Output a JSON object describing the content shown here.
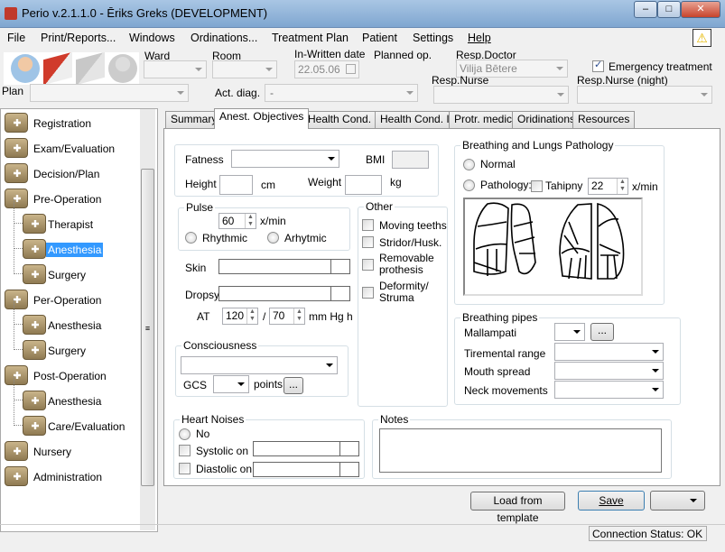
{
  "window": {
    "title": "Perio v.2.1.1.0 - Ēriks Greks (DEVELOPMENT)",
    "min": "‒",
    "max": "□",
    "close": "✕"
  },
  "menu": [
    "File",
    "Print/Reports...",
    "Windows",
    "Ordinations...",
    "Treatment Plan",
    "Patient",
    "Settings",
    "Help"
  ],
  "header": {
    "ward_label": "Ward",
    "room_label": "Room",
    "date_label": "In-Written date",
    "date_value": "22.05.06",
    "planned_label": "Planned op.",
    "doctor_label": "Resp.Doctor",
    "doctor_value": "Vilija Bētere",
    "emergency_label": "Emergency treatment",
    "emergency_checked": true,
    "plan_label": "Plan",
    "diag_label": "Act. diag.",
    "diag_value": "-",
    "nurse_label": "Resp.Nurse",
    "night_nurse_label": "Resp.Nurse (night)"
  },
  "sidebar": [
    {
      "label": "Registration",
      "level": 0
    },
    {
      "label": "Exam/Evaluation",
      "level": 0
    },
    {
      "label": "Decision/Plan",
      "level": 0
    },
    {
      "label": "Pre-Operation",
      "level": 0
    },
    {
      "label": "Therapist",
      "level": 1
    },
    {
      "label": "Anesthesia",
      "level": 1,
      "selected": true
    },
    {
      "label": "Surgery",
      "level": 1
    },
    {
      "label": "Per-Operation",
      "level": 0
    },
    {
      "label": "Anesthesia",
      "level": 1
    },
    {
      "label": "Surgery",
      "level": 1
    },
    {
      "label": "Post-Operation",
      "level": 0
    },
    {
      "label": "Anesthesia",
      "level": 1
    },
    {
      "label": "Care/Evaluation",
      "level": 1
    },
    {
      "label": "Nursery",
      "level": 0
    },
    {
      "label": "Administration",
      "level": 0
    }
  ],
  "tabs": [
    "Summary",
    "Anest. Objectives",
    "Health Cond. I",
    "Health Cond. II",
    "Protr. medic.",
    "Oridinations",
    "Resources"
  ],
  "form": {
    "fatness": "Fatness",
    "bmi": "BMI",
    "height": "Height",
    "cm": "cm",
    "weight": "Weight",
    "kg": "kg",
    "pulse": "Pulse",
    "pulse_value": "60",
    "xmin": "x/min",
    "rhythmic": "Rhythmic",
    "arhytmic": "Arhytmic",
    "skin": "Skin",
    "dropsy": "Dropsy",
    "at": "AT",
    "at_sys": "120",
    "slash": "/",
    "at_dia": "70",
    "mmhg": "mm Hg h",
    "consciousness": "Consciousness",
    "gcs": "GCS",
    "points": "points",
    "dots": "...",
    "other": "Other",
    "moving_teeth": "Moving teeths",
    "stridor": "Stridor/Husk.",
    "removable": "Removable prothesis",
    "deformity": "Deformity/ Struma",
    "breathing": "Breathing and Lungs Pathology",
    "normal": "Normal",
    "pathology": "Pathology:",
    "tahipny": "Tahipny",
    "tahipny_value": "22",
    "pipes": "Breathing pipes",
    "mallampati": "Mallampati",
    "tiremental": "Tiremental range",
    "mouth": "Mouth spread",
    "neck": "Neck movements",
    "heart": "Heart Noises",
    "no": "No",
    "systolic": "Systolic on",
    "diastolic": "Diastolic on",
    "notes": "Notes"
  },
  "footer": {
    "load": "Load from template",
    "save": "Save",
    "status": "Connection Status: OK"
  },
  "icons": [
    "doctor-icon",
    "book-icon",
    "book-delete-icon",
    "user-next-icon",
    "warning-icon"
  ]
}
